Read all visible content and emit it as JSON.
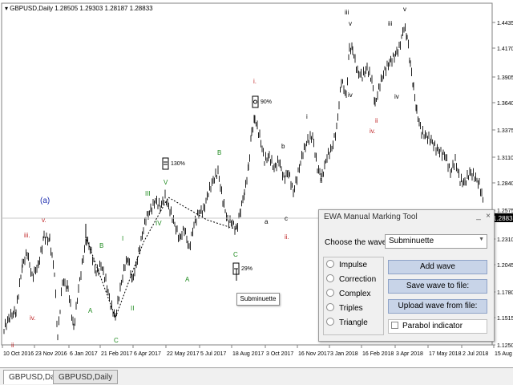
{
  "header": {
    "symbol_text": "GBPUSD,Daily  1.28505 1.29303 1.28187 1.28833"
  },
  "price_axis": {
    "labels": [
      "1.4435",
      "1.4170",
      "1.3905",
      "1.3640",
      "1.3375",
      "1.3110",
      "1.2840",
      "1.2575",
      "1.2310",
      "1.2045",
      "1.1780",
      "1.1515",
      "1.1250"
    ],
    "current_price": "1.28833"
  },
  "time_axis": {
    "labels": [
      "10 Oct 2016",
      "23 Nov 2016",
      "6 Jan 2017",
      "21 Feb 2017",
      "6 Apr 2017",
      "22 May 2017",
      "5 Jul 2017",
      "18 Aug 2017",
      "3 Oct 2017",
      "16 Nov 2017",
      "3 Jan 2018",
      "16 Feb 2018",
      "3 Apr 2018",
      "17 May 2018",
      "2 Jul 2018",
      "15 Aug 2"
    ]
  },
  "colors": {
    "red": "#c0282a",
    "green": "#1e8a1e",
    "blue": "#2030b0",
    "dark": "#000000",
    "price_line": "#c8c8c8",
    "button": "#c8d4e8"
  },
  "wave_labels": [
    {
      "t": "(a)",
      "c": "blue"
    },
    {
      "t": "v.",
      "c": "red"
    },
    {
      "t": "iii.",
      "c": "red"
    },
    {
      "t": "iv.",
      "c": "red"
    },
    {
      "t": "ii",
      "c": "red"
    },
    {
      "t": "A",
      "c": "green"
    },
    {
      "t": "B",
      "c": "green"
    },
    {
      "t": "C",
      "c": "green"
    },
    {
      "t": "I",
      "c": "green"
    },
    {
      "t": "II",
      "c": "green"
    },
    {
      "t": "III",
      "c": "green"
    },
    {
      "t": "IV",
      "c": "green"
    },
    {
      "t": "V",
      "c": "green"
    },
    {
      "t": "A",
      "c": "green"
    },
    {
      "t": "B",
      "c": "green"
    },
    {
      "t": "C",
      "c": "green"
    },
    {
      "t": "i.",
      "c": "red"
    },
    {
      "t": "b",
      "c": "dark"
    },
    {
      "t": "a",
      "c": "dark"
    },
    {
      "t": "c",
      "c": "dark"
    },
    {
      "t": "ii.",
      "c": "red"
    },
    {
      "t": "i",
      "c": "dark"
    },
    {
      "t": "ii",
      "c": "dark"
    },
    {
      "t": "iii",
      "c": "dark"
    },
    {
      "t": "iv",
      "c": "dark"
    },
    {
      "t": "v",
      "c": "dark"
    },
    {
      "t": "iv.",
      "c": "red"
    },
    {
      "t": "iii",
      "c": "dark"
    },
    {
      "t": "iv",
      "c": "dark"
    },
    {
      "t": "v",
      "c": "dark"
    },
    {
      "t": "ii",
      "c": "red"
    }
  ],
  "annotations": {
    "pct_130": "130%",
    "pct_90": "90%",
    "pct_29": "29%",
    "tooltip": "Subminuette"
  },
  "tool": {
    "title": "EWA Manual Marking Tool",
    "minimize": "_",
    "close": "×",
    "choose_label": "Choose the wave:",
    "selected_wave": "Subminuette",
    "wave_types": [
      "Impulse",
      "Correction",
      "Complex",
      "Triples",
      "Triangle"
    ],
    "buttons": {
      "add": "Add wave",
      "save": "Save wave to file:",
      "upload": "Upload wave from file:"
    },
    "parabol_label": "Parabol indicator"
  },
  "tabs": [
    "GBPUSD,Daily",
    "GBPUSD,Daily"
  ]
}
